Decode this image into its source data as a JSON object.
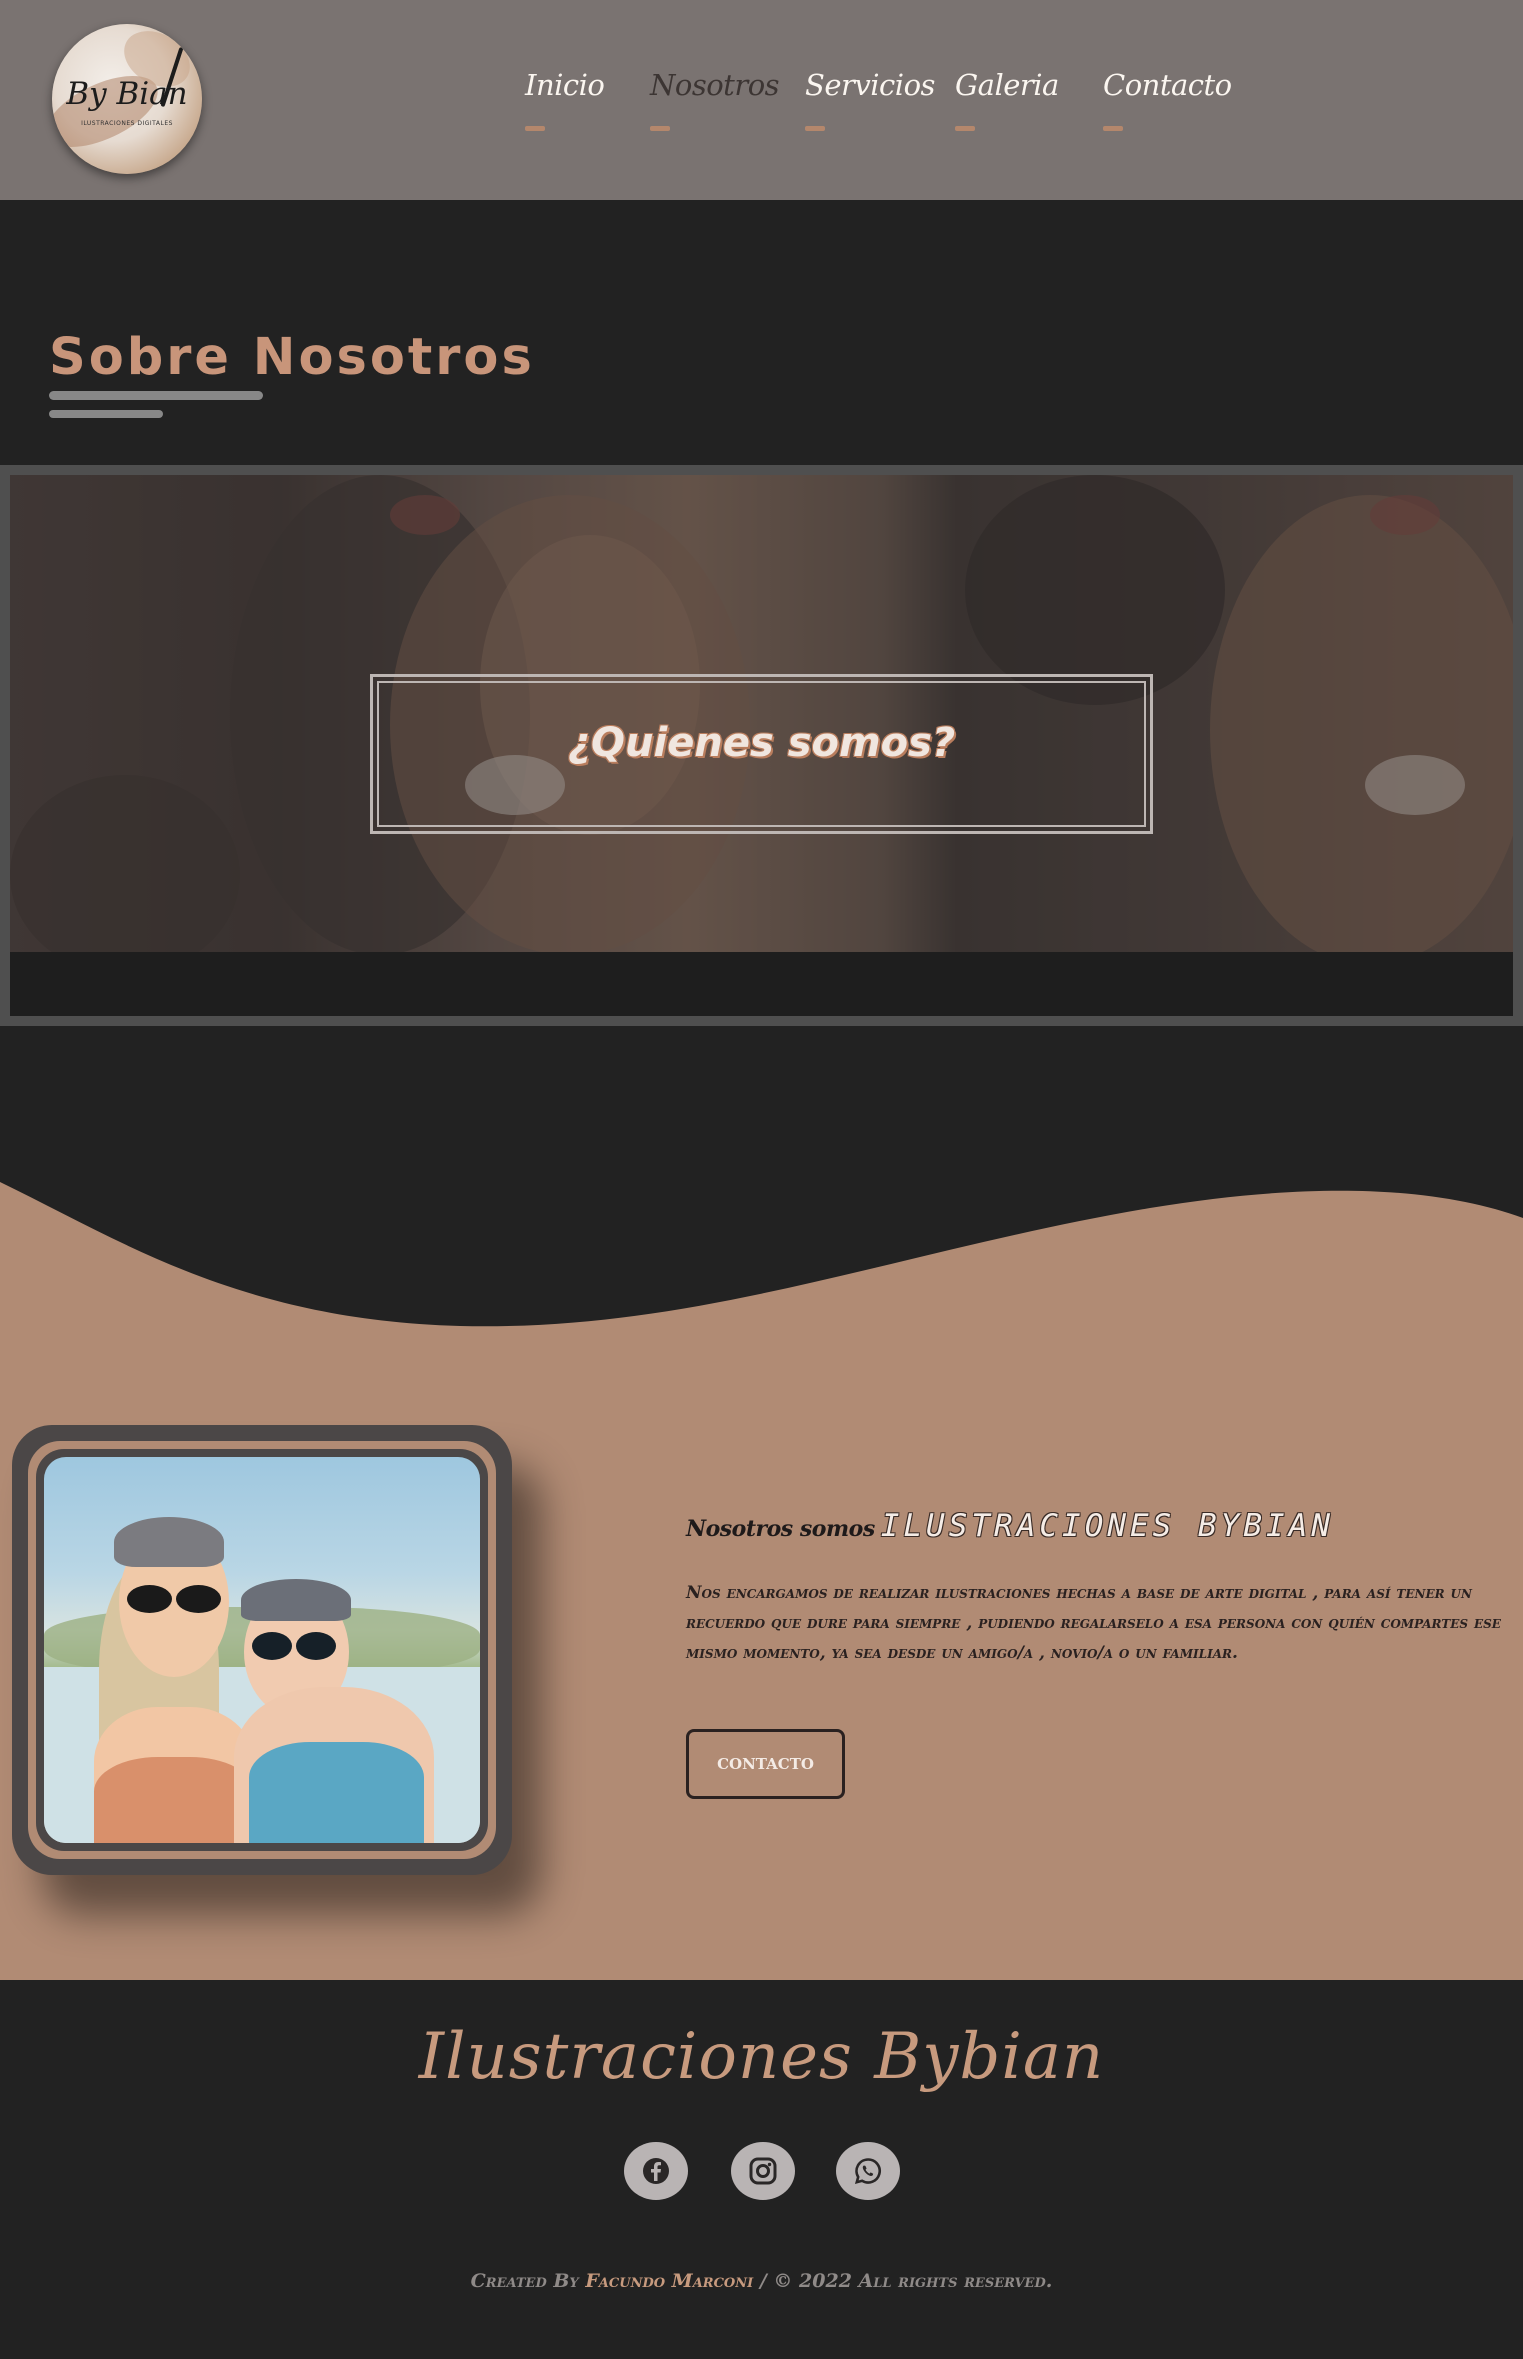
{
  "logo": {
    "text": "By Bian",
    "subtitle": "ILUSTRACIONES DIGITALES"
  },
  "nav": {
    "items": [
      {
        "label": "Inicio"
      },
      {
        "label": "Nosotros"
      },
      {
        "label": "Servicios"
      },
      {
        "label": "Galeria"
      },
      {
        "label": "Contacto"
      }
    ],
    "active": "Nosotros"
  },
  "about_section": {
    "title": "Sobre Nosotros"
  },
  "banner": {
    "title": "¿Quienes somos?"
  },
  "about": {
    "heading_prefix": "Nosotros somos",
    "heading_brand": "ILUSTRACIONES BYBIAN",
    "body": "Nos encargamos de realizar ilustraciones hechas a base de arte digital , para así tener un recuerdo que dure para siempre , pudiendo regalarselo a esa persona con quién compartes ese mismo momento, ya sea desde un amigo/a , novio/a o un familiar.",
    "button_label": "CONTACTO"
  },
  "footer": {
    "title": "Ilustraciones Bybian",
    "social": [
      "facebook-icon",
      "instagram-icon",
      "whatsapp-icon"
    ],
    "credit_prefix": "Created By",
    "credit_author": "Facundo Marconi",
    "credit_suffix": "/ © 2022 All rights reserved."
  },
  "colors": {
    "header_bg": "#7a7371",
    "page_bg": "#222222",
    "accent": "#b18b74",
    "title": "#c8957a"
  }
}
